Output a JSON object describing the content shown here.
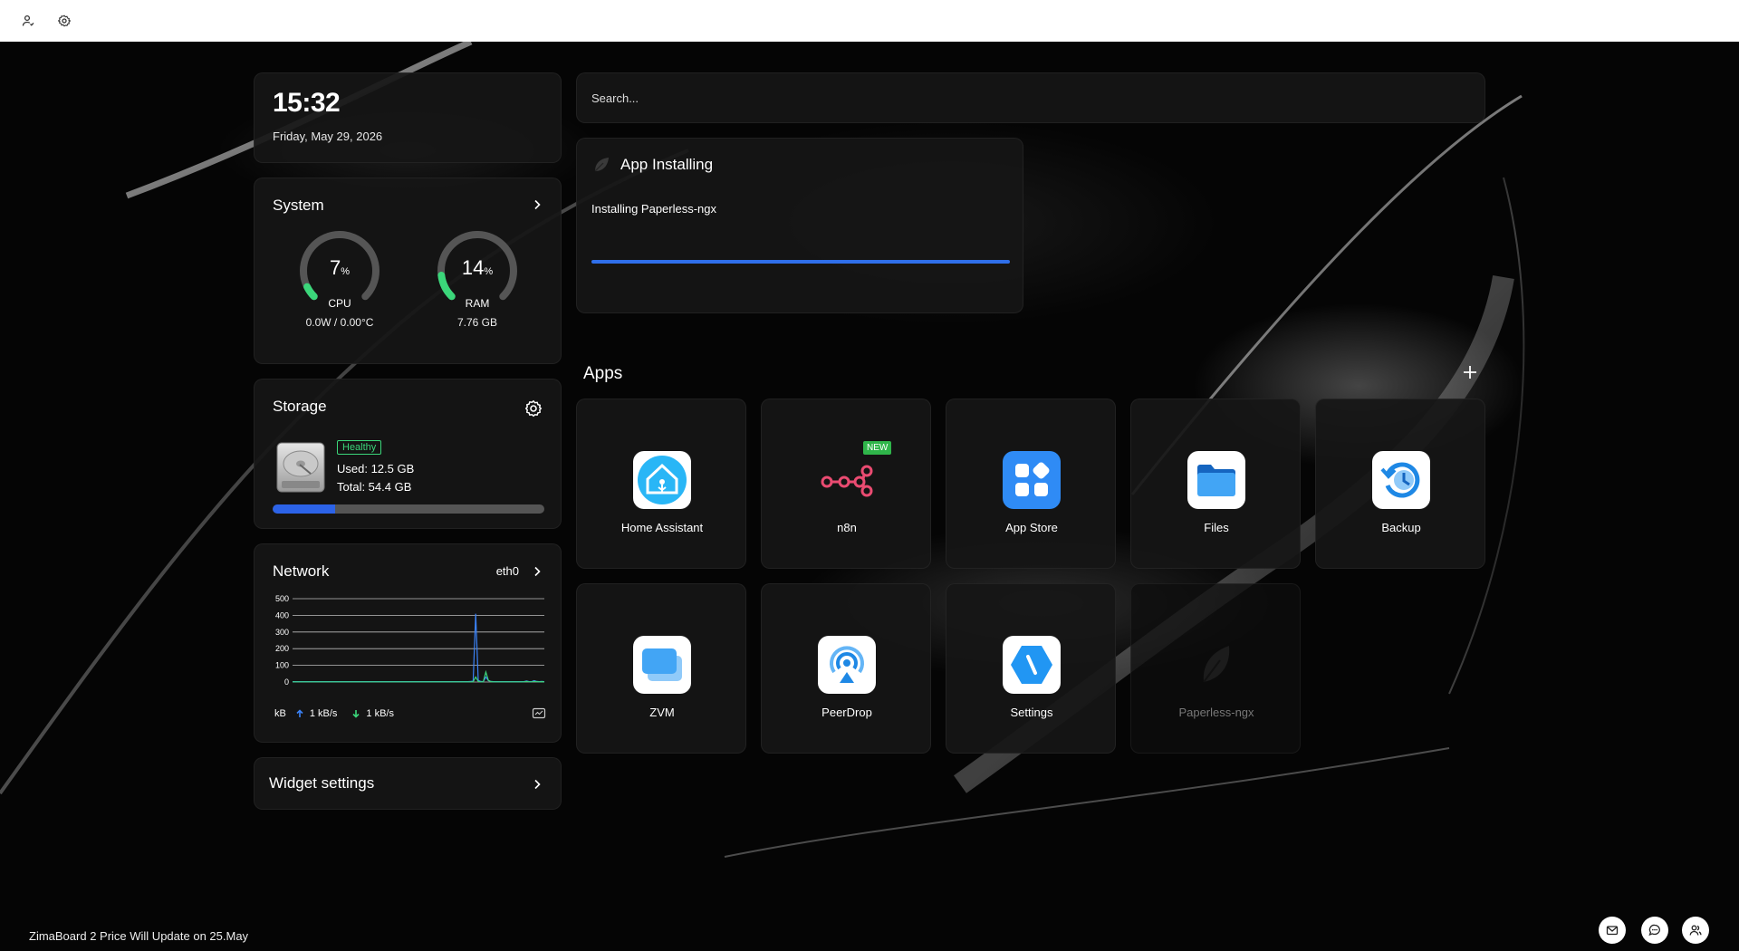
{
  "topbar": {
    "icons": [
      "account-icon",
      "settings-icon"
    ]
  },
  "clock": {
    "time": "15:32",
    "date": "Friday, May 29, 2026"
  },
  "system": {
    "title": "System",
    "cpu": {
      "value": "7",
      "unit": "%",
      "label": "CPU",
      "sub": "0.0W / 0.00°C",
      "percent": 7
    },
    "ram": {
      "value": "14",
      "unit": "%",
      "label": "RAM",
      "sub": "7.76 GB",
      "percent": 14
    },
    "gauge_color": "#3bd67a"
  },
  "storage": {
    "title": "Storage",
    "status": "Healthy",
    "used": "Used: 12.5 GB",
    "total": "Total: 54.4 GB",
    "used_fraction": 0.23,
    "accent": "#2c63e8"
  },
  "network": {
    "title": "Network",
    "interface": "eth0",
    "unit": "kB",
    "upload": "1 kB/s",
    "download": "1 kB/s",
    "chart_data": {
      "type": "line",
      "yticks": [
        500,
        400,
        300,
        200,
        100,
        0
      ],
      "ylim": [
        0,
        500
      ],
      "series": [
        {
          "color": "#3b82f6",
          "values": [
            2,
            2,
            2,
            2,
            2,
            2,
            2,
            2,
            2,
            2,
            2,
            2,
            2,
            2,
            2,
            2,
            2,
            2,
            2,
            2,
            2,
            2,
            2,
            2,
            2,
            2,
            2,
            2,
            2,
            2,
            2,
            2,
            2,
            2,
            2,
            2,
            2,
            2,
            2,
            2,
            2,
            2,
            2,
            2,
            2,
            2,
            2,
            2,
            2,
            2,
            2,
            2,
            2,
            2,
            2,
            2,
            2,
            2,
            2,
            2,
            2,
            2,
            2,
            2,
            2,
            2,
            2,
            2,
            2,
            2,
            3,
            5,
            410,
            10,
            3,
            2,
            30,
            8,
            3,
            2,
            2,
            2,
            2,
            2,
            2,
            2,
            2,
            2,
            2,
            2,
            2,
            2,
            6,
            2,
            2,
            8,
            3,
            2,
            4,
            2
          ]
        },
        {
          "color": "#3bd67a",
          "values": [
            1,
            1,
            1,
            1,
            1,
            1,
            1,
            1,
            1,
            1,
            1,
            1,
            1,
            1,
            1,
            1,
            1,
            1,
            1,
            1,
            1,
            1,
            1,
            1,
            1,
            1,
            1,
            1,
            1,
            1,
            1,
            1,
            1,
            1,
            1,
            1,
            1,
            1,
            1,
            1,
            1,
            1,
            1,
            1,
            1,
            1,
            1,
            1,
            1,
            1,
            1,
            1,
            1,
            1,
            1,
            1,
            1,
            1,
            1,
            1,
            1,
            1,
            1,
            1,
            1,
            1,
            1,
            1,
            1,
            1,
            1,
            1,
            30,
            4,
            1,
            1,
            60,
            10,
            2,
            1,
            1,
            1,
            1,
            1,
            1,
            1,
            1,
            1,
            1,
            1,
            1,
            1,
            3,
            1,
            1,
            4,
            2,
            1,
            2,
            1
          ]
        }
      ]
    }
  },
  "widgets": {
    "title": "Widget settings"
  },
  "search": {
    "placeholder": "Search..."
  },
  "installing": {
    "title": "App Installing",
    "message": "Installing Paperless-ngx",
    "progress": 1.0
  },
  "apps": {
    "title": "Apps",
    "items": [
      {
        "label": "Home Assistant",
        "icon": "home-assistant-icon"
      },
      {
        "label": "n8n",
        "icon": "n8n-icon",
        "badge": "NEW"
      },
      {
        "label": "App Store",
        "icon": "app-store-icon"
      },
      {
        "label": "Files",
        "icon": "files-icon"
      },
      {
        "label": "Backup",
        "icon": "backup-icon"
      },
      {
        "label": "ZVM",
        "icon": "zvm-icon"
      },
      {
        "label": "PeerDrop",
        "icon": "peerdrop-icon"
      },
      {
        "label": "Settings",
        "icon": "settings-app-icon"
      },
      {
        "label": "Paperless-ngx",
        "icon": "paperless-icon"
      }
    ]
  },
  "ticker": "ZimaBoard 2 Price Will Update on 25.May",
  "bottom_icons": [
    "mail-icon",
    "chat-icon",
    "people-icon"
  ]
}
